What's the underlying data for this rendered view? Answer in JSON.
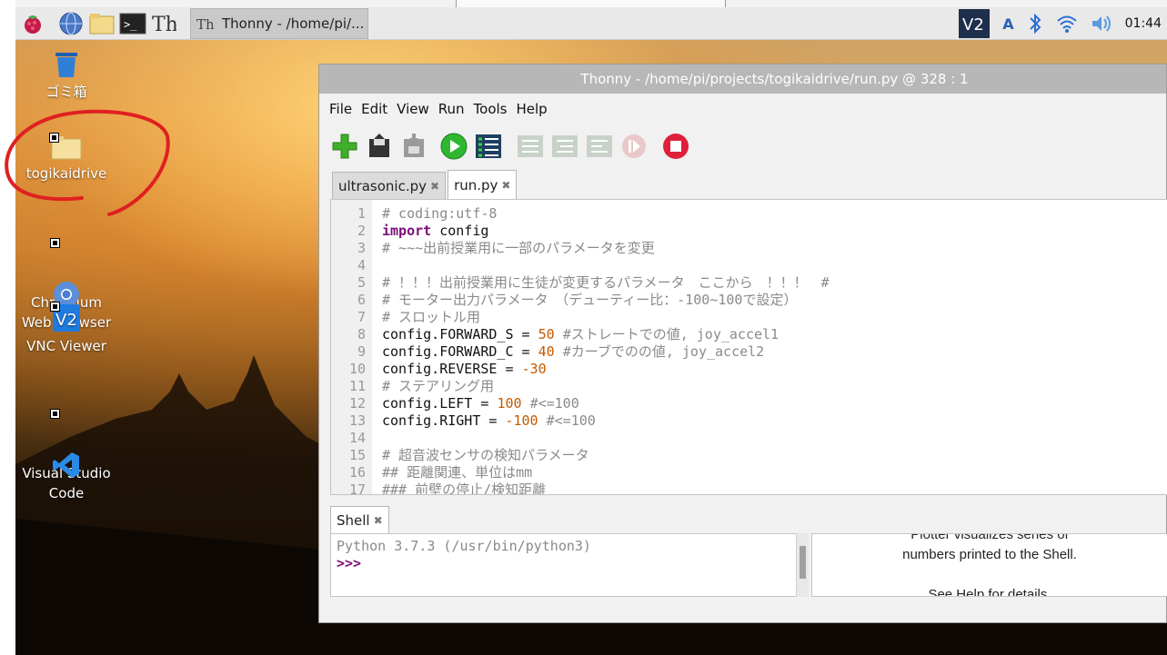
{
  "panel": {
    "task_title": "Thonny  -  /home/pi/...",
    "clock": "01:44",
    "keyboard_indicator": "A"
  },
  "desktop": {
    "icons": [
      {
        "label": "ゴミ箱"
      },
      {
        "label": "togikaidrive"
      },
      {
        "label": "Chromium\nWeb Browser"
      },
      {
        "label": "VNC Viewer"
      },
      {
        "label": "Visual Studio\nCode"
      }
    ]
  },
  "window": {
    "title": "Thonny  -  /home/pi/projects/togikaidrive/run.py  @  328 : 1",
    "menu": [
      "File",
      "Edit",
      "View",
      "Run",
      "Tools",
      "Help"
    ],
    "tabs": [
      {
        "label": "ultrasonic.py"
      },
      {
        "label": "run.py"
      }
    ],
    "close_glyph": "✖",
    "editor_lines": [
      {
        "n": "1",
        "text": "# coding:utf-8"
      },
      {
        "n": "2",
        "text": "import config"
      },
      {
        "n": "3",
        "text": "# ~~~出前授業用に一部のパラメータを変更"
      },
      {
        "n": "4",
        "text": ""
      },
      {
        "n": "5",
        "text": "# ！！！出前授業用に生徒が変更するパラメータ　ここから　！！！　#"
      },
      {
        "n": "6",
        "text": "# モーター出力パラメータ　（デューティー比：-100~100で設定）"
      },
      {
        "n": "7",
        "text": "# スロットル用"
      },
      {
        "n": "8",
        "text": "config.FORWARD_S = 50 #ストレートでの値, joy_accel1"
      },
      {
        "n": "9",
        "text": "config.FORWARD_C = 40 #カーブでのの値, joy_accel2"
      },
      {
        "n": "10",
        "text": "config.REVERSE = -30"
      },
      {
        "n": "11",
        "text": "# ステアリング用"
      },
      {
        "n": "12",
        "text": "config.LEFT = 100 #<=100"
      },
      {
        "n": "13",
        "text": "config.RIGHT = -100 #<=100"
      },
      {
        "n": "14",
        "text": ""
      },
      {
        "n": "15",
        "text": "# 超音波センサの検知パラメータ"
      },
      {
        "n": "16",
        "text": "## 距離関連、単位はmm"
      },
      {
        "n": "17",
        "text": "### 前壁の停止/検知距離"
      }
    ],
    "shell": {
      "tab_label": "Shell",
      "banner": "Python 3.7.3 (/usr/bin/python3)",
      "prompt": ">>>"
    },
    "plotter": {
      "line1": "Plotter visualizes series of",
      "line2": "numbers printed to the Shell.",
      "line3": "See Help for details."
    }
  },
  "colors": {
    "annotation": "#e02020",
    "kw": "#7a0e7a",
    "num": "#c45a00",
    "comment": "#8a8a8a"
  }
}
